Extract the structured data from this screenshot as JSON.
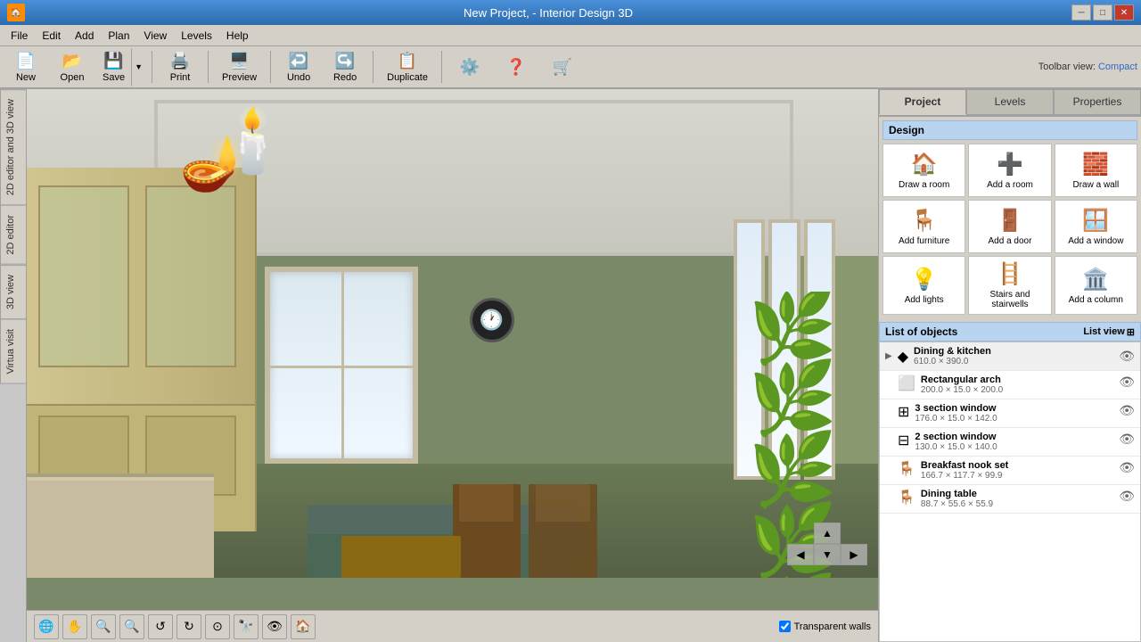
{
  "titlebar": {
    "icon": "🏠",
    "title": "New Project, - Interior Design 3D",
    "min_btn": "─",
    "max_btn": "□",
    "close_btn": "✕"
  },
  "menubar": {
    "items": [
      "File",
      "Edit",
      "Add",
      "Plan",
      "View",
      "Levels",
      "Help"
    ]
  },
  "toolbar": {
    "new_label": "New",
    "open_label": "Open",
    "save_label": "Save",
    "print_label": "Print",
    "preview_label": "Preview",
    "undo_label": "Undo",
    "redo_label": "Redo",
    "duplicate_label": "Duplicate",
    "settings_label": "",
    "help_label": "",
    "toolbar_label": "",
    "toolbar_view_prefix": "Toolbar view:",
    "toolbar_compact": "Compact"
  },
  "left_tabs": {
    "items": [
      "2D editor and 3D view",
      "2D editor",
      "3D view",
      "Virtua visit"
    ]
  },
  "viewport": {
    "transparent_walls_label": "Transparent walls"
  },
  "right_panel": {
    "tabs": [
      "Project",
      "Levels",
      "Properties"
    ],
    "active_tab": "Project",
    "design_header": "Design",
    "design_buttons": [
      {
        "label": "Draw a room",
        "icon": "🏠"
      },
      {
        "label": "Add a room",
        "icon": "➕"
      },
      {
        "label": "Draw a wall",
        "icon": "🧱"
      },
      {
        "label": "Add furniture",
        "icon": "🛋️"
      },
      {
        "label": "Add a door",
        "icon": "🚪"
      },
      {
        "label": "Add a window",
        "icon": "🪟"
      },
      {
        "label": "Add lights",
        "icon": "💡"
      },
      {
        "label": "Stairs and stairwells",
        "icon": "🪜"
      },
      {
        "label": "Add a column",
        "icon": "🏛️"
      }
    ],
    "objects_header": "List of objects",
    "list_view_label": "List view",
    "objects": [
      {
        "type": "group",
        "icon": "◆",
        "name": "Dining & kitchen",
        "dims": "610.0 × 390.0"
      },
      {
        "type": "item",
        "icon": "▭",
        "name": "Rectangular arch",
        "dims": "200.0 × 15.0 × 200.0"
      },
      {
        "type": "item",
        "icon": "⊞",
        "name": "3 section window",
        "dims": "176.0 × 15.0 × 142.0"
      },
      {
        "type": "item",
        "icon": "⊟",
        "name": "2 section window",
        "dims": "130.0 × 15.0 × 140.0"
      },
      {
        "type": "item",
        "icon": "🪑",
        "name": "Breakfast nook set",
        "dims": "166.7 × 117.7 × 99.9"
      },
      {
        "type": "item",
        "icon": "🪑",
        "name": "Dining table",
        "dims": "88.7 × 55.6 × 55.9"
      }
    ]
  },
  "bottom_toolbar": {
    "buttons": [
      "🌐",
      "✋",
      "🔍−",
      "🔍+",
      "↺",
      "↻",
      "⊙",
      "🔭",
      "👁",
      "🏠"
    ]
  }
}
